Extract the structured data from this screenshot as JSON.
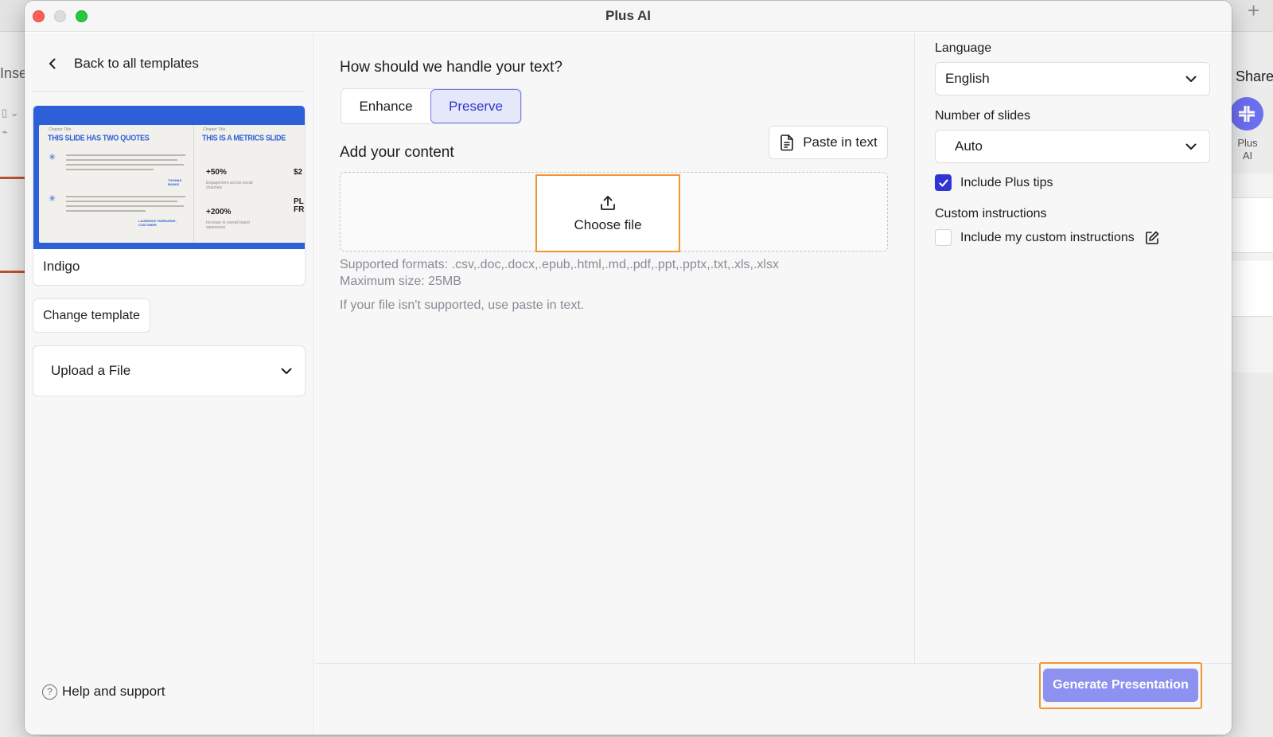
{
  "window": {
    "title": "Plus AI"
  },
  "background": {
    "left_text": "Inse",
    "share_label": "Share",
    "plus_ai_label": "Plus AI"
  },
  "left": {
    "back_label": "Back to all templates",
    "template": {
      "name": "Indigo",
      "preview": {
        "slide1_heading": "THIS SLIDE HAS TWO QUOTES",
        "slide2_heading": "THIS IS A METRICS SLIDE",
        "chapter_label": "Chapter Title",
        "author1": "THOMAS BANKS",
        "author2": "LAURENCE FAIRBURNE, CUSTOMER",
        "metric1": "+50%",
        "metric2": "+200%",
        "metric3": "$2",
        "metric4": "PL FR",
        "metric1_caption": "Engagement across social channels",
        "metric2_caption": "Increase in overall brand awareness"
      }
    },
    "change_template_label": "Change template",
    "upload_select_label": "Upload a File",
    "help_label": "Help and support"
  },
  "center": {
    "question": "How should we handle your text?",
    "modes": [
      "Enhance",
      "Preserve"
    ],
    "selected_mode": "Preserve",
    "add_content_label": "Add your content",
    "paste_label": "Paste in text",
    "choose_file_label": "Choose file",
    "formats_text": "Supported formats: .csv,.doc,.docx,.epub,.html,.md,.pdf,.ppt,.pptx,.txt,.xls,.xlsx",
    "max_size_text": "Maximum size: 25MB",
    "unsupported_text": "If your file isn't supported, use paste in text."
  },
  "right": {
    "language_label": "Language",
    "language_value": "English",
    "slides_label": "Number of slides",
    "slides_value": "Auto",
    "plus_tips_label": "Include Plus tips",
    "plus_tips_checked": true,
    "custom_heading": "Custom instructions",
    "custom_label": "Include my custom instructions",
    "custom_checked": false
  },
  "footer": {
    "generate_label": "Generate Presentation"
  },
  "colors": {
    "accent": "#2f34d2",
    "selected_mode_bg": "#e5e7fb",
    "highlight_outline": "#f0962f",
    "generate_bg": "#8d91f0",
    "template_blue": "#2d5fd6"
  },
  "icons": {
    "back": "chevron-left-icon",
    "upload": "upload-icon",
    "paste": "document-icon",
    "dropdown": "chevron-down-icon",
    "help": "question-circle-icon",
    "edit": "edit-icon"
  }
}
